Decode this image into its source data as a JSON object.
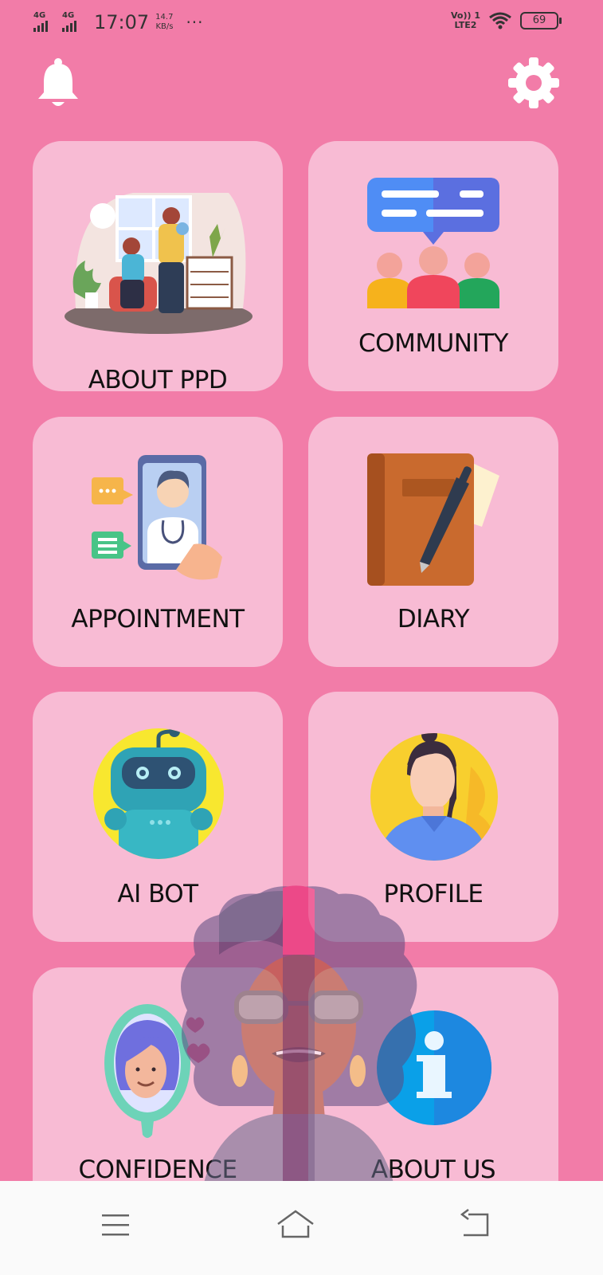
{
  "status_bar": {
    "network1": "4G",
    "network2": "4G",
    "time": "17:07",
    "speed_value": "14.7",
    "speed_unit": "KB/s",
    "more": "···",
    "volte_line1": "Vo)) 1",
    "volte_line2": "LTE2",
    "battery": "69"
  },
  "header": {
    "bell_icon": "bell-icon",
    "settings_icon": "gear-icon"
  },
  "cards": [
    {
      "label": "ABOUT PPD",
      "icon": "ppd-illustration"
    },
    {
      "label": "COMMUNITY",
      "icon": "community-icon"
    },
    {
      "label": "APPOINTMENT",
      "icon": "doctor-phone-icon"
    },
    {
      "label": "DIARY",
      "icon": "diary-icon"
    },
    {
      "label": "AI BOT",
      "icon": "robot-icon"
    },
    {
      "label": "PROFILE",
      "icon": "profile-icon"
    },
    {
      "label": "CONFIDENCE",
      "icon": "mirror-icon"
    },
    {
      "label": "ABOUT US",
      "icon": "info-icon"
    }
  ],
  "nav": {
    "menu_icon": "menu-icon",
    "home_icon": "home-icon",
    "back_icon": "back-icon"
  },
  "colors": {
    "background": "#f27ca8",
    "card": "#f8bbd4",
    "nav_bar": "#fafafa"
  }
}
